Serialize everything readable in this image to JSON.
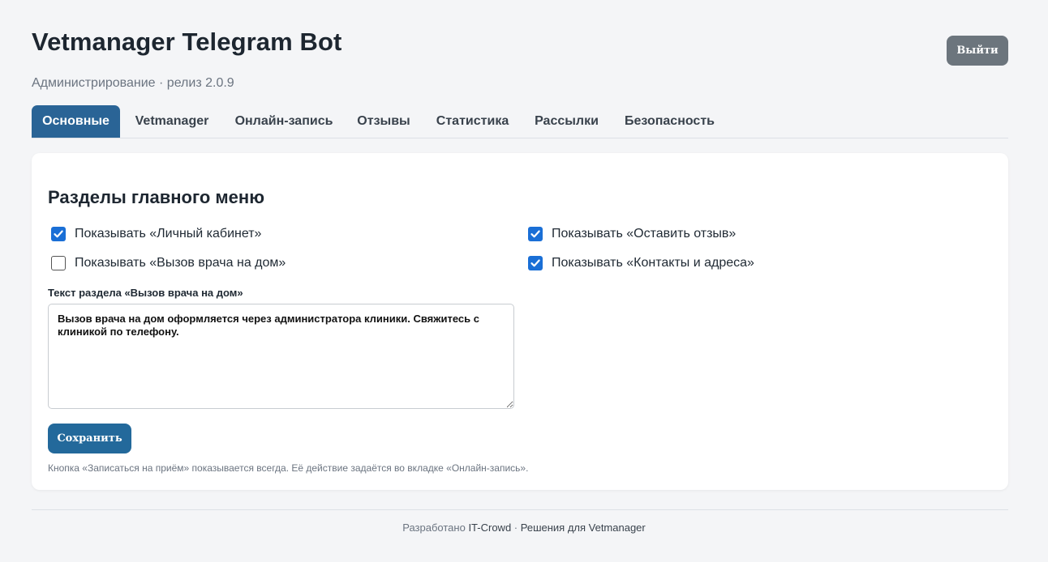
{
  "header": {
    "title": "Vetmanager Telegram Bot",
    "subtitle": "Администрирование · релиз 2.0.9",
    "logout_label": "Выйти"
  },
  "tabs": [
    {
      "label": "Основные",
      "active": true
    },
    {
      "label": "Vetmanager",
      "active": false
    },
    {
      "label": "Онлайн-запись",
      "active": false
    },
    {
      "label": "Отзывы",
      "active": false
    },
    {
      "label": "Статистика",
      "active": false
    },
    {
      "label": "Рассылки",
      "active": false
    },
    {
      "label": "Безопасность",
      "active": false
    }
  ],
  "section": {
    "title": "Разделы главного меню",
    "options": [
      {
        "label": "Показывать «Личный кабинет»",
        "checked": true
      },
      {
        "label": "Показывать «Вызов врача на дом»",
        "checked": false
      },
      {
        "label": "Показывать «Оставить отзыв»",
        "checked": true
      },
      {
        "label": "Показывать «Контакты и адреса»",
        "checked": true
      }
    ],
    "textarea_label": "Текст раздела «Вызов врача на дом»",
    "textarea_value": "Вызов врача на дом оформляется через администратора клиники. Свяжитесь с клиникой по телефону.",
    "save_label": "Сохранить",
    "hint": "Кнопка «Записаться на приём» показывается всегда. Её действие задаётся во вкладке «Онлайн-запись»."
  },
  "footer": {
    "prefix": "Разработано ",
    "company": "IT-Crowd",
    "separator": " · ",
    "tagline": "Решения для Vetmanager"
  },
  "colors": {
    "accent": "#2a6496",
    "checkbox": "#1a6fd6",
    "logout": "#6c757d",
    "background": "#f4f5f7"
  }
}
